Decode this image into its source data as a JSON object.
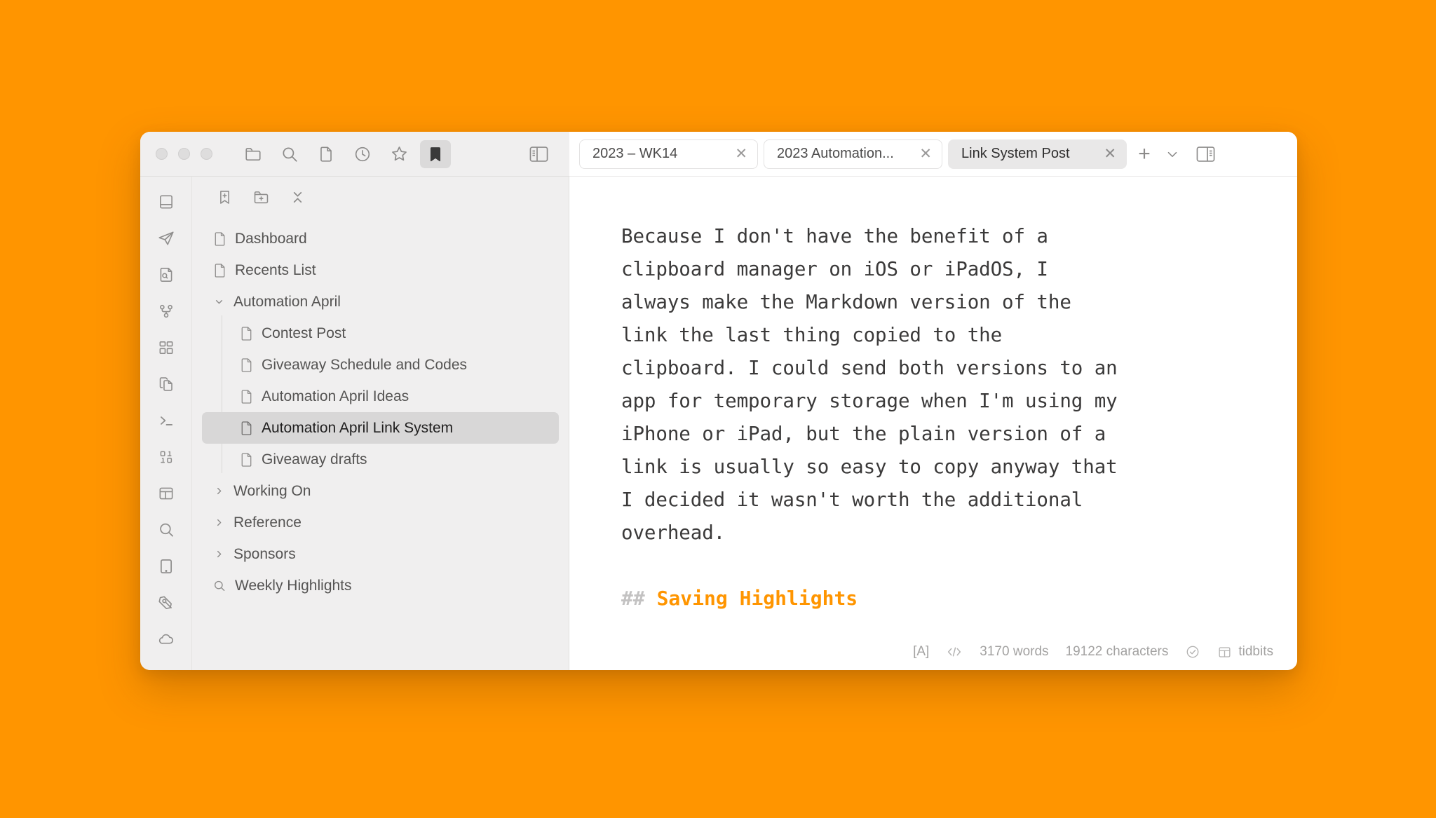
{
  "desktop": {
    "background_color": "#ff9500"
  },
  "window": {
    "accent_color": "#ff9500",
    "titlebar": {
      "traffic_lights": [
        "close",
        "minimize",
        "zoom"
      ],
      "toolbar_buttons": [
        {
          "name": "folder",
          "icon": "folder-icon",
          "active": false
        },
        {
          "name": "search",
          "icon": "search-icon",
          "active": false
        },
        {
          "name": "documents",
          "icon": "document-icon",
          "active": false
        },
        {
          "name": "recents",
          "icon": "clock-icon",
          "active": false
        },
        {
          "name": "favorites",
          "icon": "star-icon",
          "active": false
        },
        {
          "name": "bookmarks",
          "icon": "bookmark-icon",
          "active": true
        }
      ],
      "sidebar_toggle": "left-sidebar-toggle-icon"
    },
    "tabs": [
      {
        "label": "2023 – WK14",
        "close": "✕",
        "active": false
      },
      {
        "label": "2023 Automation...",
        "close": "✕",
        "active": false
      },
      {
        "label": "Link System Post",
        "close": "✕",
        "active": true
      }
    ],
    "tab_controls": {
      "add_label": "+",
      "add_name": "new-tab-button",
      "overflow_name": "tab-overflow-chevron",
      "inspector_name": "right-inspector-toggle"
    }
  },
  "rail": {
    "items": [
      {
        "icon": "book-icon",
        "label": "Library"
      },
      {
        "icon": "paper-plane-icon",
        "label": "Publish"
      },
      {
        "icon": "document-search-icon",
        "label": "Find in files"
      },
      {
        "icon": "share-nodes-icon",
        "label": "Connections"
      },
      {
        "icon": "grid-icon",
        "label": "Dashboard"
      },
      {
        "icon": "copy-documents-icon",
        "label": "Templates"
      },
      {
        "icon": "terminal-icon",
        "label": "Terminal"
      },
      {
        "icon": "binary-icon",
        "label": "Code"
      },
      {
        "icon": "layout-icon",
        "label": "Layout"
      },
      {
        "icon": "search-icon",
        "label": "Search"
      },
      {
        "icon": "tablet-icon",
        "label": "Preview"
      },
      {
        "icon": "pen-nib-icon",
        "label": "Draw"
      },
      {
        "icon": "cloud-icon",
        "label": "Sync"
      }
    ]
  },
  "sidebar": {
    "toolbar": [
      {
        "icon": "add-bookmark-icon",
        "label": "New bookmark"
      },
      {
        "icon": "add-folder-icon",
        "label": "New folder"
      },
      {
        "icon": "collapse-all-icon",
        "label": "Collapse all"
      }
    ],
    "tree": [
      {
        "label": "Dashboard",
        "kind": "file",
        "depth": 0,
        "selected": false
      },
      {
        "label": "Recents List",
        "kind": "file",
        "depth": 0,
        "selected": false
      },
      {
        "label": "Automation April",
        "kind": "group",
        "expanded": true,
        "depth": 0,
        "selected": false
      },
      {
        "label": "Contest Post",
        "kind": "file",
        "depth": 1,
        "selected": false
      },
      {
        "label": "Giveaway Schedule and Codes",
        "kind": "file",
        "depth": 1,
        "selected": false
      },
      {
        "label": "Automation April Ideas",
        "kind": "file",
        "depth": 1,
        "selected": false
      },
      {
        "label": "Automation April Link System",
        "kind": "file",
        "depth": 1,
        "selected": true
      },
      {
        "label": "Giveaway drafts",
        "kind": "file",
        "depth": 1,
        "selected": false
      },
      {
        "label": "Working On",
        "kind": "group",
        "expanded": false,
        "depth": 0,
        "selected": false
      },
      {
        "label": "Reference",
        "kind": "group",
        "expanded": false,
        "depth": 0,
        "selected": false
      },
      {
        "label": "Sponsors",
        "kind": "group",
        "expanded": false,
        "depth": 0,
        "selected": false
      },
      {
        "label": "Weekly Highlights",
        "kind": "saved-search",
        "depth": 0,
        "selected": false
      }
    ]
  },
  "editor": {
    "paragraph": "Because I don't have the benefit of a\nclipboard manager on iOS or iPadOS, I\nalways make the Markdown version of the\nlink the last thing copied to the\nclipboard. I could send both versions to an\napp for temporary storage when I'm using my\niPhone or iPad, but the plain version of a\nlink is usually so easy to copy anyway that\nI decided it wasn't worth the additional\noverhead.",
    "heading_marker": "## ",
    "heading_text": "Saving Highlights",
    "heading_color": "#ff9500"
  },
  "statusbar": {
    "mode": "[A]",
    "code_icon": "code-icon",
    "words": "3170 words",
    "characters": "19122 characters",
    "check_icon": "check-circle-icon",
    "layout_icon": "layout-panel-icon",
    "destination": "tidbits"
  }
}
